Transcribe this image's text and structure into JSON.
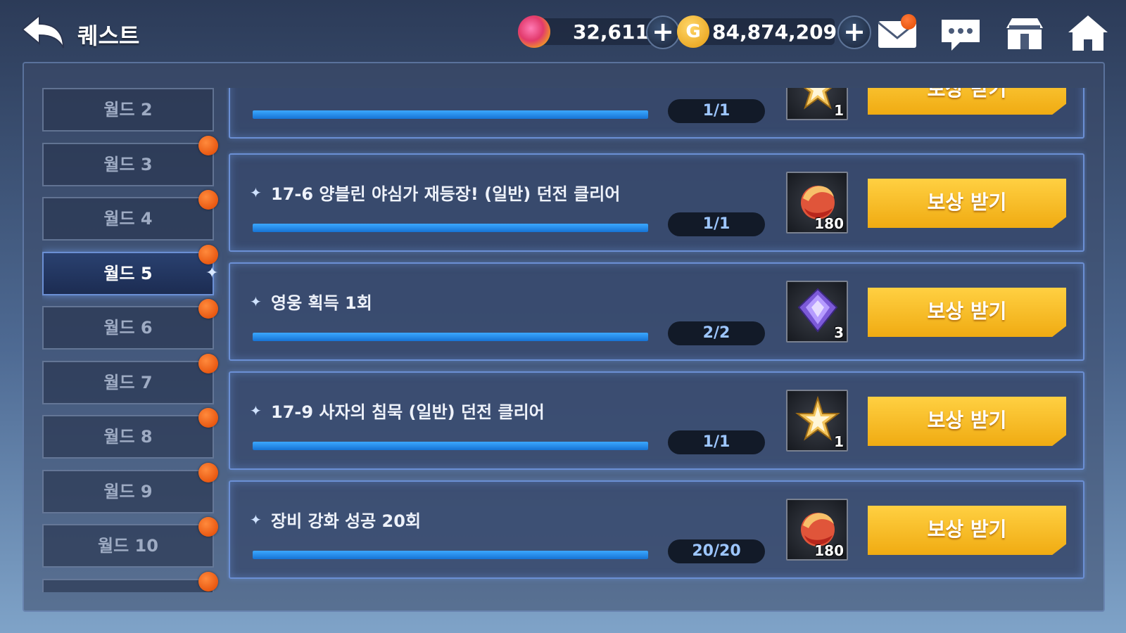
{
  "header": {
    "title": "퀘스트",
    "gem_amount": "32,611",
    "gold_amount": "84,874,209"
  },
  "icons": {
    "back": "back-arrow-icon",
    "gem": "gem-icon",
    "gold": "gold-coin-icon",
    "mail": "mail-icon",
    "chat": "chat-icon",
    "shop": "shop-icon",
    "home": "home-icon"
  },
  "sidebar": {
    "tabs": [
      {
        "label": "월드 2",
        "active": false,
        "notify": false
      },
      {
        "label": "월드 3",
        "active": false,
        "notify": true
      },
      {
        "label": "월드 4",
        "active": false,
        "notify": true
      },
      {
        "label": "월드 5",
        "active": true,
        "notify": true
      },
      {
        "label": "월드 6",
        "active": false,
        "notify": true
      },
      {
        "label": "월드 7",
        "active": false,
        "notify": true
      },
      {
        "label": "월드 8",
        "active": false,
        "notify": true
      },
      {
        "label": "월드 9",
        "active": false,
        "notify": true
      },
      {
        "label": "월드 10",
        "active": false,
        "notify": true
      },
      {
        "label": "",
        "active": false,
        "notify": true
      }
    ]
  },
  "quests": [
    {
      "text": "",
      "progress": "1/1",
      "fill": 1.0,
      "reward_type": "star-medal-icon",
      "reward_qty": "1",
      "claim_label": "보상 받기"
    },
    {
      "text": "17-6 양블린 야심가 재등장! (일반) 던전 클리어",
      "progress": "1/1",
      "fill": 1.0,
      "reward_type": "red-orb-icon",
      "reward_qty": "180",
      "claim_label": "보상 받기"
    },
    {
      "text": "영웅 획득 1회",
      "progress": "2/2",
      "fill": 1.0,
      "reward_type": "purple-crystal-icon",
      "reward_qty": "3",
      "claim_label": "보상 받기"
    },
    {
      "text": "17-9 사자의 침묵 (일반) 던전 클리어",
      "progress": "1/1",
      "fill": 1.0,
      "reward_type": "star-medal-icon",
      "reward_qty": "1",
      "claim_label": "보상 받기"
    },
    {
      "text": "장비 강화 성공 20회",
      "progress": "20/20",
      "fill": 1.0,
      "reward_type": "red-orb-icon",
      "reward_qty": "180",
      "claim_label": "보상 받기"
    }
  ],
  "colors": {
    "accent_blue": "#3ba8ff",
    "claim_yellow": "#f7c12a",
    "notify_orange": "#f05a10"
  }
}
